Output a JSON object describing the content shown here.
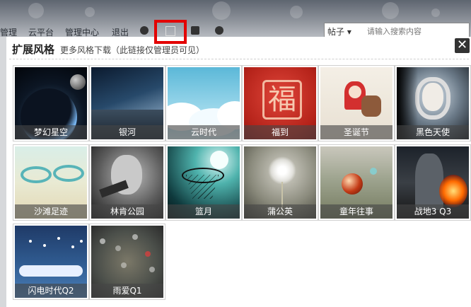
{
  "background": {
    "nav_items": [
      "管理",
      "云平台",
      "管理中心",
      "退出"
    ],
    "search": {
      "scope": "帖子 ▾",
      "placeholder": "请输入搜索内容"
    }
  },
  "popup": {
    "title": "扩展风格",
    "subtitle": "更多风格下载（此链接仅管理员可见）",
    "close_symbol": "✕"
  },
  "themes": [
    {
      "name": "梦幻星空"
    },
    {
      "name": "银河"
    },
    {
      "name": "云时代"
    },
    {
      "name": "福到",
      "glyph": "福"
    },
    {
      "name": "圣诞节"
    },
    {
      "name": "黑色天使"
    },
    {
      "name": "沙滩足迹"
    },
    {
      "name": "林肯公园"
    },
    {
      "name": "篮月"
    },
    {
      "name": "蒲公英"
    },
    {
      "name": "童年往事"
    },
    {
      "name": "战地3 Q3"
    },
    {
      "name": "闪电时代Q2"
    },
    {
      "name": "雨爱Q1"
    }
  ],
  "colors": {
    "highlight": "#e30000",
    "caption_bg": "#464646"
  }
}
